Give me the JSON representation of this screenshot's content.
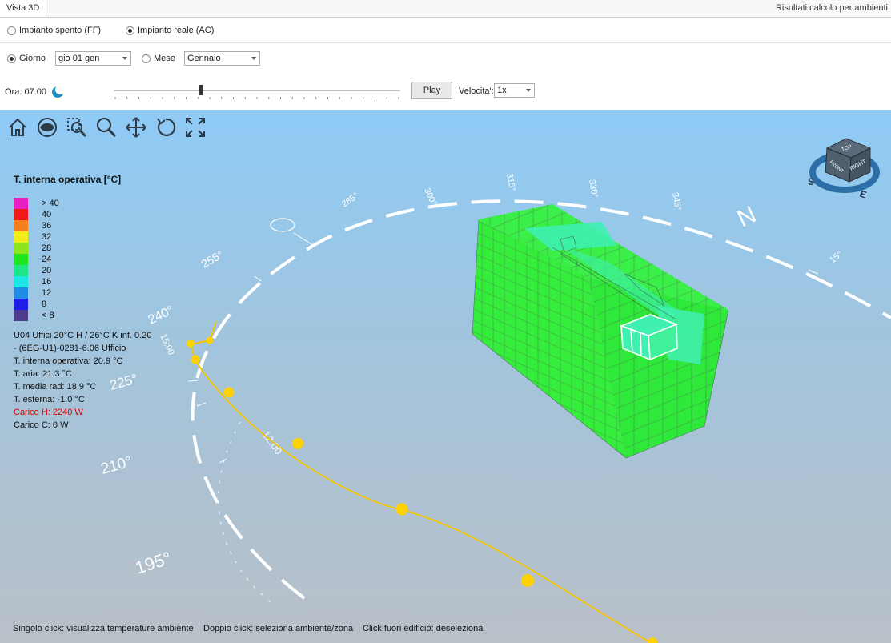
{
  "tabs": {
    "active": "Vista 3D",
    "right": "Risultati calcolo per ambienti"
  },
  "impianto": {
    "off_label": "Impianto spento (FF)",
    "on_label": "Impianto reale (AC)",
    "selected": "on"
  },
  "period": {
    "giorno_label": "Giorno",
    "giorno_value": "gio 01 gen",
    "mese_label": "Mese",
    "mese_value": "Gennaio",
    "selected": "giorno"
  },
  "time": {
    "label": "Ora: 07:00",
    "play_label": "Play",
    "speed_label": "Velocita':",
    "speed_value": "1x",
    "slider_fraction": 0.3
  },
  "legend": {
    "title": "T. interna operativa [°C]",
    "items": [
      {
        "label": "> 40",
        "color": "#e71ec2"
      },
      {
        "label": "40",
        "color": "#ee1a1a"
      },
      {
        "label": "36",
        "color": "#f3821e"
      },
      {
        "label": "32",
        "color": "#f2ec1a"
      },
      {
        "label": "28",
        "color": "#8be41e"
      },
      {
        "label": "24",
        "color": "#1fe61f"
      },
      {
        "label": "20",
        "color": "#1ee687"
      },
      {
        "label": "16",
        "color": "#1ee6e6"
      },
      {
        "label": "12",
        "color": "#1e8ce6"
      },
      {
        "label": "8",
        "color": "#1e1ee6"
      },
      {
        "label": "< 8",
        "color": "#503c8c"
      }
    ]
  },
  "info": {
    "line1": "U04 Uffici 20°C H / 26°C K inf. 0.20",
    "line2": " - (6EG-U1)-0281-6.06 Ufficio",
    "t_interna": "T. interna operativa: 20.9 °C",
    "t_aria": "T. aria: 21.3 °C",
    "t_media": "T. media rad: 18.9 °C",
    "t_esterna": "T. esterna: -1.0 °C",
    "carico_h": "Carico H: 2240 W",
    "carico_c": "Carico C: 0 W"
  },
  "compass": {
    "north": "N",
    "labels": [
      "255°",
      "240°",
      "225°",
      "210°",
      "195°",
      "285°",
      "300°",
      "315°",
      "330°",
      "345°",
      "15°"
    ],
    "time_labels": [
      "15:00",
      "12:00"
    ]
  },
  "viewcube": {
    "top": "TOP",
    "front": "FRONT",
    "right": "RIGHT",
    "s": "S",
    "e": "E"
  },
  "tools": [
    "home-icon",
    "eye-icon",
    "zoom-window-icon",
    "zoom-icon",
    "pan-icon",
    "rotate-icon",
    "fit-icon"
  ],
  "hints": {
    "h1": "Singolo click: visualizza temperature ambiente",
    "h2": "Doppio click: seleziona ambiente/zona",
    "h3": "Click fuori edificio: deseleziona"
  },
  "colors": {
    "sun_path": "#f5c400",
    "building": "#2ef23a",
    "roof_accent": "#3ff0b0"
  }
}
